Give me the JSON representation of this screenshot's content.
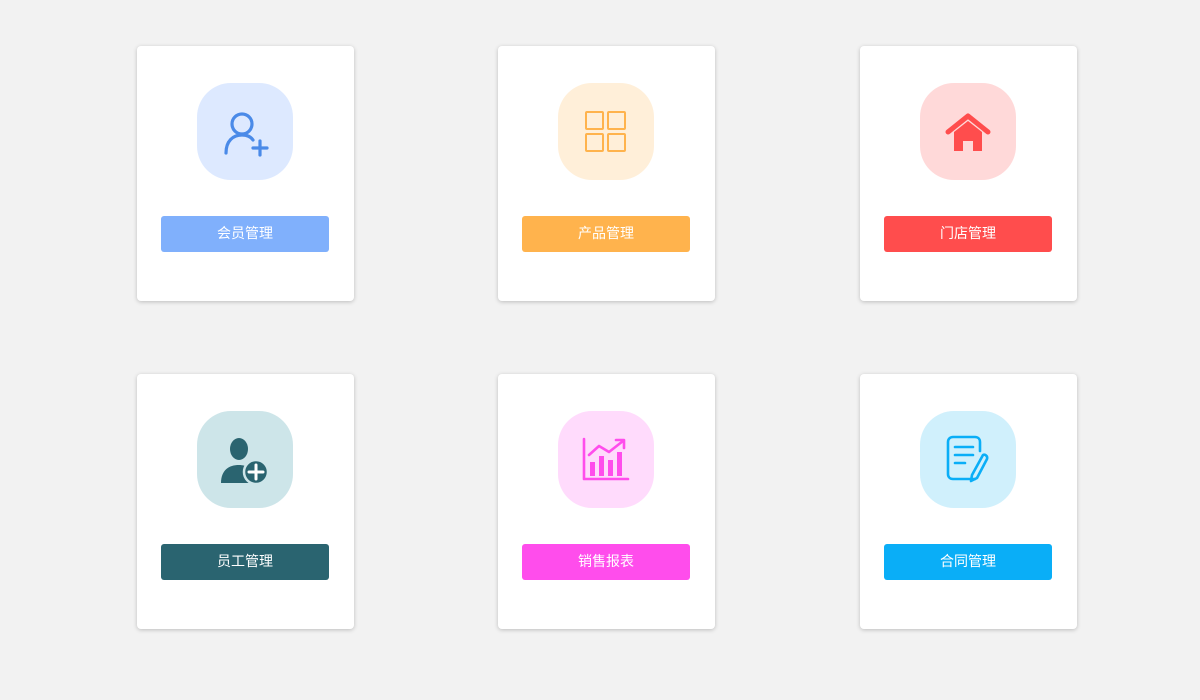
{
  "cards": [
    {
      "label": "会员管理",
      "icon": "user-add-icon",
      "accent": "#80b0fc",
      "icon_bg": "#dde9ff",
      "icon_color": "#4a8ae8"
    },
    {
      "label": "产品管理",
      "icon": "grid-icon",
      "accent": "#ffb34d",
      "icon_bg": "#ffefd9",
      "icon_color": "#ffb34d"
    },
    {
      "label": "门店管理",
      "icon": "house-icon",
      "accent": "#ff4d4d",
      "icon_bg": "#ffd9d9",
      "icon_color": "#ff4d4d"
    },
    {
      "label": "员工管理",
      "icon": "staff-add-icon",
      "accent": "#2a6470",
      "icon_bg": "#cde5e9",
      "icon_color": "#2a6470"
    },
    {
      "label": "销售报表",
      "icon": "chart-icon",
      "accent": "#ff4dec",
      "icon_bg": "#ffdbfc",
      "icon_color": "#ff4dec"
    },
    {
      "label": "合同管理",
      "icon": "contract-icon",
      "accent": "#0aaef7",
      "icon_bg": "#d0f0fc",
      "icon_color": "#0aaef7"
    }
  ]
}
